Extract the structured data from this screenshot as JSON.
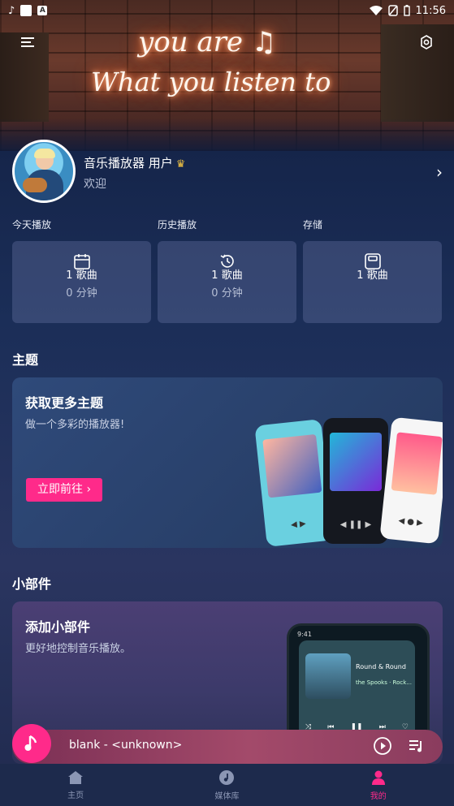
{
  "status_bar": {
    "time": "11:56",
    "battery_icon": "battery-icon",
    "wifi_icon": "wifi-icon"
  },
  "banner": {
    "line1": "you are ♫",
    "line2": "What you listen to"
  },
  "profile": {
    "name": "音乐播放器 用户",
    "welcome": "欢迎"
  },
  "stats": [
    {
      "label": "今天播放",
      "songs": "1 歌曲",
      "minutes": "0 分钟",
      "icon": "calendar-icon"
    },
    {
      "label": "历史播放",
      "songs": "1 歌曲",
      "minutes": "0 分钟",
      "icon": "history-icon"
    },
    {
      "label": "存储",
      "songs": "1 歌曲",
      "minutes": "",
      "icon": "storage-icon"
    }
  ],
  "theme_section": {
    "title": "主题",
    "card_title": "获取更多主题",
    "card_sub": "做一个多彩的播放器!",
    "button": "立即前往"
  },
  "widget_section": {
    "title": "小部件",
    "card_title": "添加小部件",
    "card_sub": "更好地控制音乐播放。",
    "preview_time": "9:41",
    "preview_song": "Round & Round",
    "preview_artist": "the Spooks · Rock..."
  },
  "player": {
    "track": "blank - <unknown>"
  },
  "nav": [
    {
      "label": "主页",
      "icon": "home-icon"
    },
    {
      "label": "媒体库",
      "icon": "library-icon"
    },
    {
      "label": "我的",
      "icon": "profile-icon"
    }
  ],
  "colors": {
    "accent": "#ff2a8a",
    "bg": "#1b2e58"
  }
}
